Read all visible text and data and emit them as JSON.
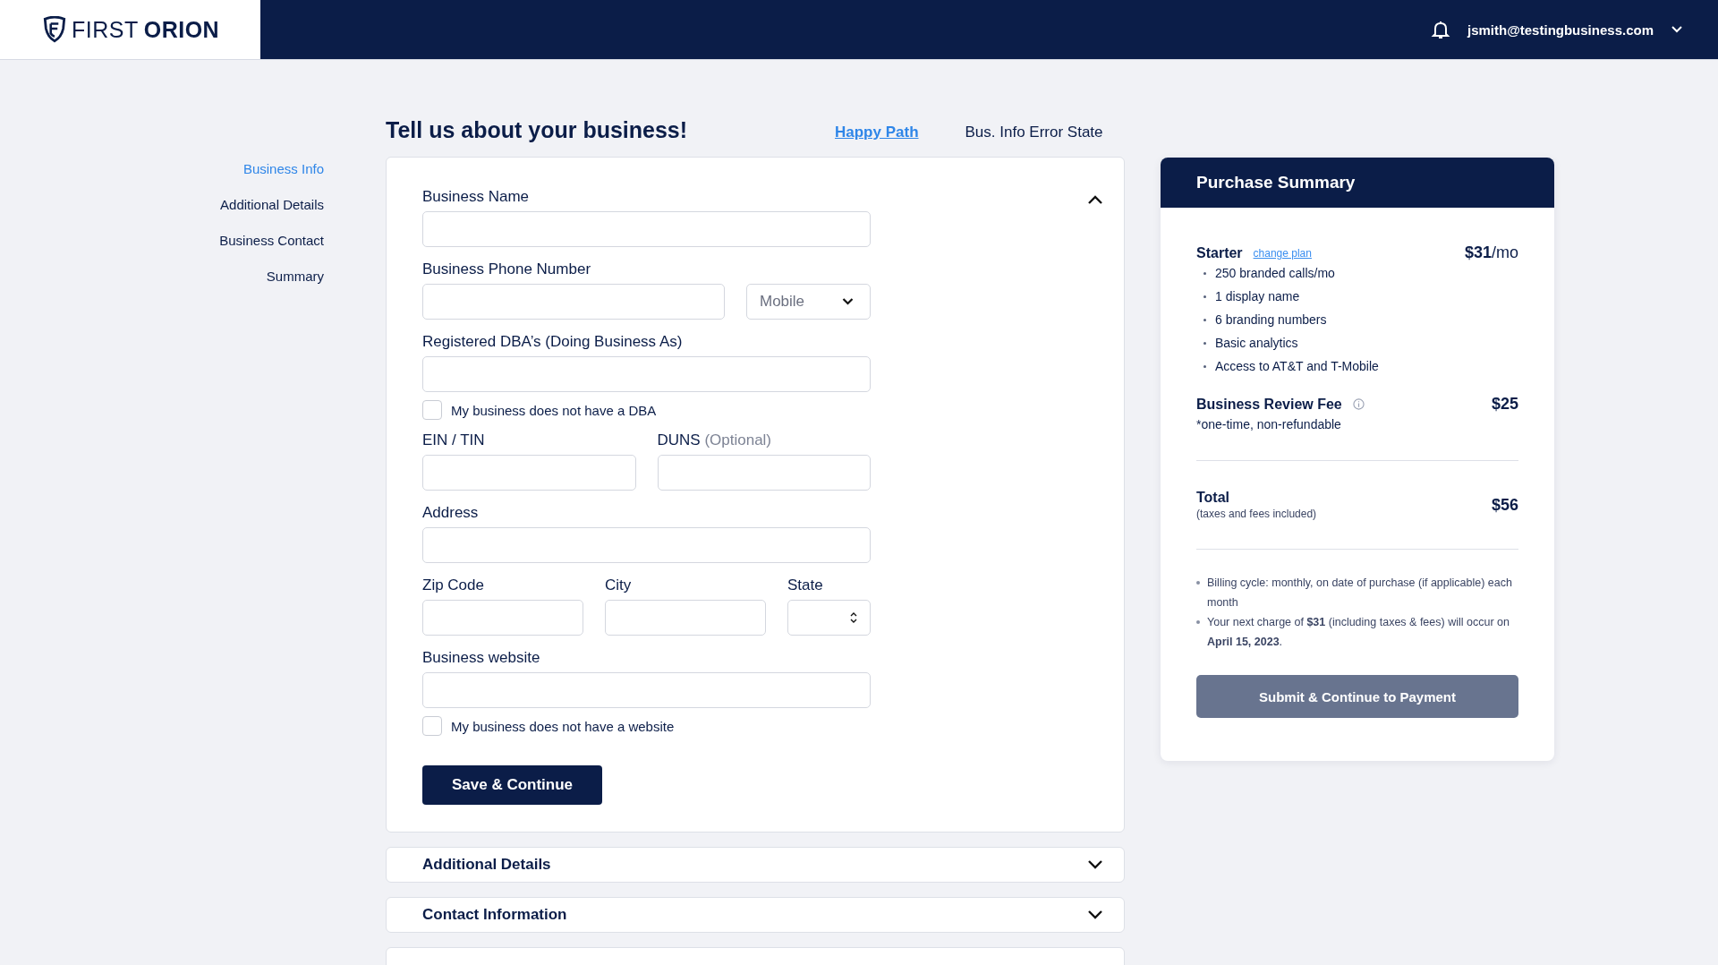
{
  "header": {
    "brand_light": "FIRST",
    "brand_bold": "ORION",
    "user_email": "jsmith@testingbusiness.com"
  },
  "steps": [
    {
      "label": "Business Info",
      "selected": true
    },
    {
      "label": "Additional Details",
      "selected": false
    },
    {
      "label": "Business Contact",
      "selected": false
    },
    {
      "label": "Summary",
      "selected": false
    }
  ],
  "page_title": "Tell us about your business!",
  "links": [
    {
      "kind": "link",
      "label": "Happy Path"
    },
    {
      "kind": "plain",
      "label": "Bus. Info Error State"
    }
  ],
  "form": {
    "expanded": true,
    "submit": "Save & Continue",
    "rows": [
      [
        {
          "kind": "field",
          "label": "Business Name"
        }
      ],
      [
        {
          "kind": "field",
          "label": "Business Phone Number"
        },
        {
          "kind": "select",
          "value": "Mobile"
        }
      ],
      [
        {
          "kind": "field",
          "label": "Registered DBA’s (Doing Business As)"
        }
      ],
      [
        {
          "kind": "checkbox",
          "label": "My business does not have a DBA",
          "checked": false
        }
      ],
      [
        {
          "kind": "field",
          "label": "EIN / TIN"
        },
        {
          "kind": "field",
          "label": "DUNS",
          "note": "(Optional)"
        }
      ],
      [
        {
          "kind": "field",
          "label": "Address"
        }
      ],
      [
        {
          "kind": "field",
          "label": "Zip Code"
        },
        {
          "kind": "field",
          "label": "City"
        },
        {
          "kind": "stepper",
          "label": "State"
        }
      ],
      [
        {
          "kind": "field",
          "label": "Business website"
        }
      ],
      [
        {
          "kind": "checkbox",
          "label": "My business does not have a website",
          "checked": false
        }
      ]
    ]
  },
  "sections": [
    {
      "title": "Additional Details",
      "expanded": false
    },
    {
      "title": "Contact Information",
      "expanded": false
    },
    {
      "expanded": false
    }
  ],
  "summary": {
    "title": "Purchase Summary",
    "plan": {
      "name": "Starter",
      "link": "change plan",
      "price": "$31",
      "per": "/mo",
      "features": [
        "250 branded calls/mo",
        "1 display name",
        "6 branding numbers",
        "Basic analytics",
        "Access to AT&T and T-Mobile"
      ]
    },
    "fee": {
      "label": "Business Review Fee",
      "note": "*one-time, non-refundable",
      "price": "$25"
    },
    "total": {
      "label": "Total",
      "note": "(taxes and fees included)",
      "price": "$56"
    },
    "notes": [
      "Billing cycle: monthly, on date of purchase (if applicable) each month",
      "Your next charge of **$31** (including taxes & fees) will occur on **April 15, 2023**."
    ],
    "button": {
      "label": "Submit & Continue to Payment",
      "disabled": true
    }
  }
}
